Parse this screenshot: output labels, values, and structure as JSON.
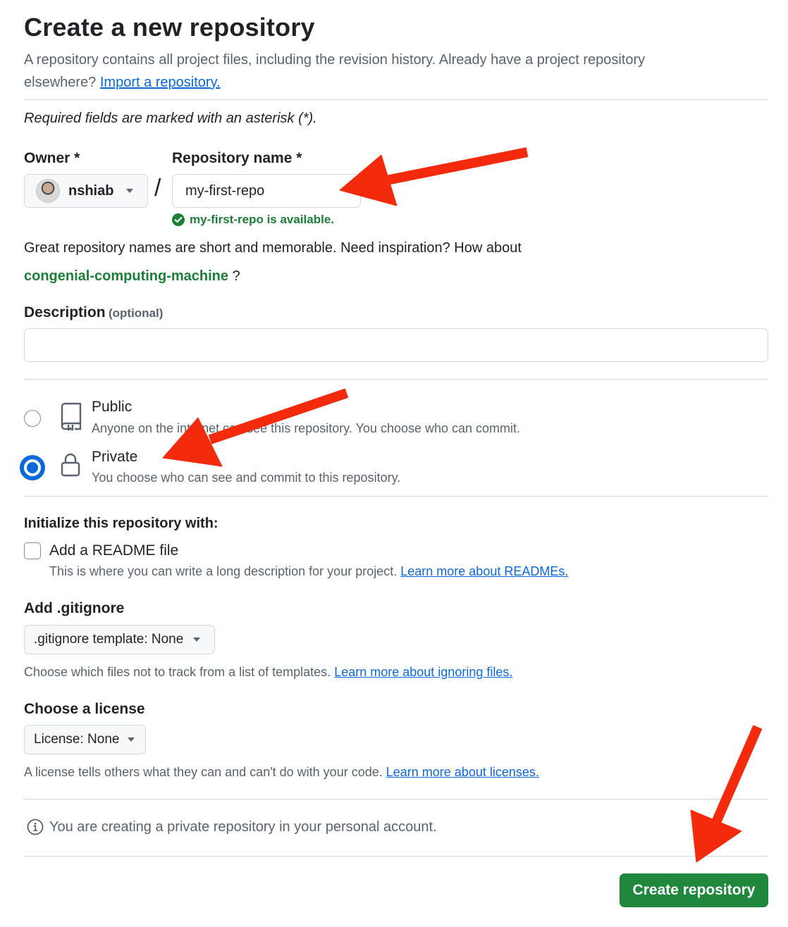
{
  "header": {
    "title": "Create a new repository",
    "intro_line1": "A repository contains all project files, including the revision history. Already have a project repository",
    "intro_line2_prefix": "elsewhere?",
    "import_link": "Import a repository."
  },
  "required_note": "Required fields are marked with an asterisk (*).",
  "owner": {
    "label": "Owner *",
    "value": "nshiab"
  },
  "separator": "/",
  "repo_name": {
    "label": "Repository name *",
    "value": "my-first-repo",
    "availability": "my-first-repo is available."
  },
  "suggestion": {
    "text": "Great repository names are short and memorable. Need inspiration? How about",
    "name": "congenial-computing-machine",
    "suffix": "?"
  },
  "description": {
    "label": "Description",
    "optional": "(optional)",
    "value": ""
  },
  "visibility": {
    "public": {
      "title": "Public",
      "desc": "Anyone on the internet can see this repository. You choose who can commit.",
      "selected": false
    },
    "private": {
      "title": "Private",
      "desc": "You choose who can see and commit to this repository.",
      "selected": true
    }
  },
  "init": {
    "heading": "Initialize this repository with:",
    "readme_label": "Add a README file",
    "readme_checked": false,
    "readme_desc": "This is where you can write a long description for your project.",
    "readme_link": "Learn more about READMEs."
  },
  "gitignore": {
    "heading": "Add .gitignore",
    "button": ".gitignore template: None",
    "desc": "Choose which files not to track from a list of templates.",
    "link": "Learn more about ignoring files."
  },
  "license": {
    "heading": "Choose a license",
    "button": "License: None",
    "desc": "A license tells others what they can and can't do with your code.",
    "link": "Learn more about licenses."
  },
  "notice": "You are creating a private repository in your personal account.",
  "submit": "Create repository",
  "icons": [
    "repo-icon",
    "lock-icon",
    "info-icon",
    "check-circle-icon",
    "caret-down-icon",
    "annotation-arrow"
  ],
  "colors": {
    "primary_button": "#1f883d",
    "link": "#0969da",
    "success": "#1a7f37",
    "annotation": "#f42a0c",
    "radio_selected": "#0969da"
  }
}
